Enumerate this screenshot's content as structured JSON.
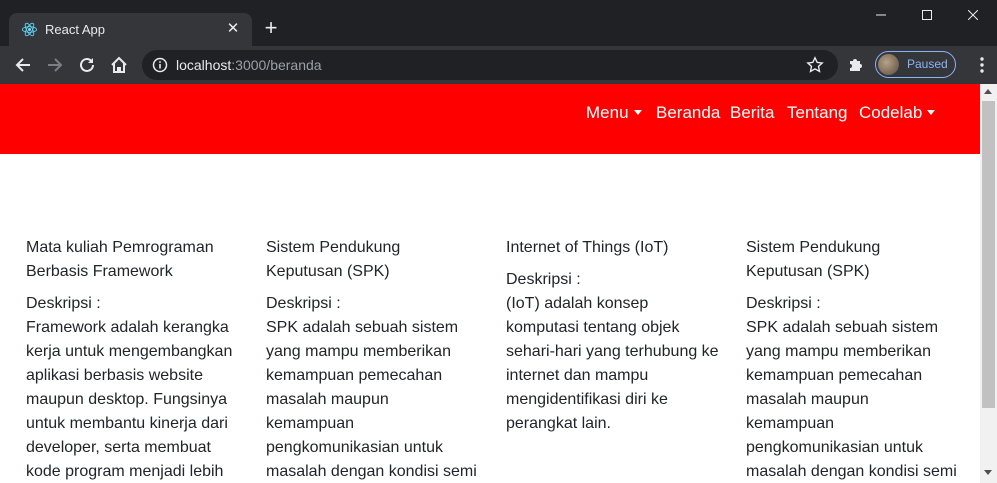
{
  "browser": {
    "tab_title": "React App",
    "url_host": "localhost",
    "url_path": ":3000/beranda",
    "profile_label": "Paused"
  },
  "colors": {
    "navbar": "#ff0000",
    "profile_accent": "#8ab4f8"
  },
  "navbar": {
    "items": [
      {
        "label": "Menu",
        "dropdown": true
      },
      {
        "label": "Beranda",
        "dropdown": false
      },
      {
        "label": "Berita",
        "dropdown": false
      },
      {
        "label": "Tentang",
        "dropdown": false
      },
      {
        "label": "Codelab",
        "dropdown": true
      }
    ]
  },
  "cards": [
    {
      "title": "Mata kuliah Pemrograman Berbasis Framework",
      "desc_label": "Deskripsi :",
      "desc": "Framework adalah kerangka kerja untuk mengembangkan aplikasi berbasis website maupun desktop. Fungsinya untuk membantu kinerja dari developer, serta membuat kode program menjadi lebih"
    },
    {
      "title": "Sistem Pendukung Keputusan (SPK)",
      "desc_label": "Deskripsi :",
      "desc": "SPK adalah sebuah sistem yang mampu memberikan kemampuan pemecahan masalah maupun kemampuan pengkomunikasian untuk masalah dengan kondisi semi"
    },
    {
      "title": "Internet of Things (IoT)",
      "desc_label": "Deskripsi :",
      "desc": "(IoT) adalah konsep komputasi tentang objek sehari-hari yang terhubung ke internet dan mampu mengidentifikasi diri ke perangkat lain."
    },
    {
      "title": "Sistem Pendukung Keputusan (SPK)",
      "desc_label": "Deskripsi :",
      "desc": "SPK adalah sebuah sistem yang mampu memberikan kemampuan pemecahan masalah maupun kemampuan pengkomunikasian untuk masalah dengan kondisi semi"
    }
  ]
}
